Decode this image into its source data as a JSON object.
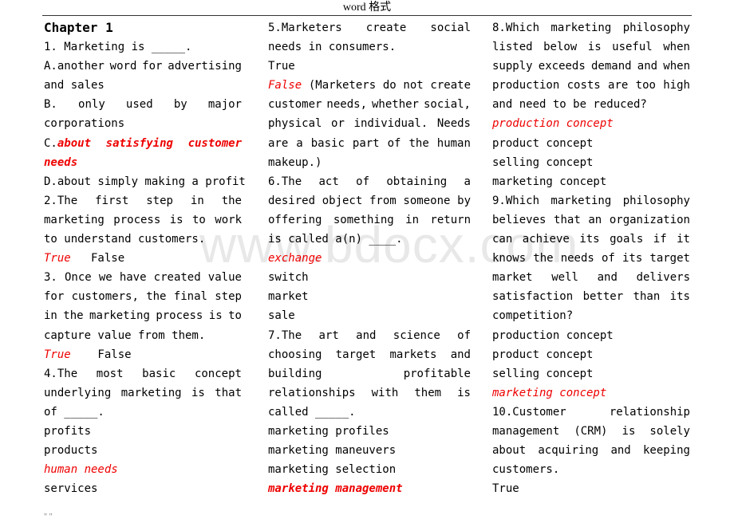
{
  "header": {
    "title": "word 格式"
  },
  "watermark": "www.bdocx.com",
  "footer": {
    "text": "\" \""
  },
  "columns": [
    {
      "lines": [
        {
          "text": "Chapter 1",
          "style": "chapter"
        },
        {
          "text": "1. Marketing is _____."
        },
        {
          "text": "A.another word for advertising",
          "justify": true
        },
        {
          "text": "and sales"
        },
        {
          "text": "B.    only    used    by    major",
          "justify": true
        },
        {
          "text": "corporations"
        },
        {
          "prefix": "C.",
          "text": "about  satisfying  customer",
          "style": "ans-bold",
          "justify": true
        },
        {
          "text": "needs",
          "style": "ans-bold"
        },
        {
          "text": "D.about simply making a profit"
        },
        {
          "text": "2.The  first  step  in  the",
          "justify": true
        },
        {
          "text": "marketing process is to work",
          "justify": true
        },
        {
          "text": "to understand customers."
        },
        {
          "text": "True",
          "style": "ans",
          "suffix": "   False"
        },
        {
          "text": "3. Once we have created value",
          "justify": true
        },
        {
          "text": "for customers, the final step",
          "justify": true
        },
        {
          "text": "in the marketing process is to",
          "justify": true
        },
        {
          "text": "capture value from them."
        },
        {
          "text": "True",
          "style": "ans",
          "suffix": "    False"
        },
        {
          "text": "4.The  most  basic  concept",
          "justify": true
        },
        {
          "text": "underlying marketing is that",
          "justify": true
        },
        {
          "text": "of _____."
        },
        {
          "text": "profits"
        },
        {
          "text": "products"
        },
        {
          "text": "human needs",
          "style": "ans"
        },
        {
          "text": "services"
        }
      ]
    },
    {
      "lines": [
        {
          "text": "5.Marketers  create  social",
          "justify": true
        },
        {
          "text": "needs in consumers."
        },
        {
          "text": "True"
        },
        {
          "text": "False",
          "style": "ans",
          "suffix": " (Marketers do not create",
          "justify": true
        },
        {
          "text": "customer needs, whether social,",
          "justify": true
        },
        {
          "text": "physical or individual.  Needs",
          "justify": true
        },
        {
          "text": "are a basic part of the human",
          "justify": true
        },
        {
          "text": "makeup.)"
        },
        {
          "text": "6.The  act  of  obtaining  a",
          "justify": true
        },
        {
          "text": "desired object from someone by",
          "justify": true
        },
        {
          "text": "offering something in return",
          "justify": true
        },
        {
          "text": "is called a(n) ____."
        },
        {
          "text": "exchange",
          "style": "ans"
        },
        {
          "text": "switch"
        },
        {
          "text": "market"
        },
        {
          "text": "sale"
        },
        {
          "text": "7.The  art  and  science  of",
          "justify": true
        },
        {
          "text": "choosing target markets and",
          "justify": true
        },
        {
          "text": "building  profitable",
          "justify": true
        },
        {
          "text": "relationships with them is",
          "justify": true
        },
        {
          "text": "called _____."
        },
        {
          "text": "marketing profiles"
        },
        {
          "text": "marketing maneuvers"
        },
        {
          "text": "marketing selection"
        },
        {
          "text": "marketing management",
          "style": "ans-bold"
        }
      ]
    },
    {
      "lines": [
        {
          "text": "8.Which marketing philosophy",
          "justify": true
        },
        {
          "text": "listed below is useful when",
          "justify": true
        },
        {
          "text": "supply exceeds demand and when",
          "justify": true
        },
        {
          "text": "production costs are too high",
          "justify": true
        },
        {
          "text": "and need to be reduced?"
        },
        {
          "text": "production concept",
          "style": "ans"
        },
        {
          "text": "product concept"
        },
        {
          "text": "selling concept"
        },
        {
          "text": "marketing concept"
        },
        {
          "text": "9.Which marketing philosophy",
          "justify": true
        },
        {
          "text": "believes that an organization",
          "justify": true
        },
        {
          "text": "can achieve its goals if it",
          "justify": true
        },
        {
          "text": "knows the needs of its target",
          "justify": true
        },
        {
          "text": "market well and delivers",
          "justify": true
        },
        {
          "text": "satisfaction better than its",
          "justify": true
        },
        {
          "text": "competition?"
        },
        {
          "text": "production concept"
        },
        {
          "text": "product concept"
        },
        {
          "text": "selling concept"
        },
        {
          "text": "marketing concept",
          "style": "ans"
        },
        {
          "text": "10.Customer  relationship",
          "justify": true
        },
        {
          "text": "management (CRM) is solely",
          "justify": true
        },
        {
          "text": "about acquiring and keeping",
          "justify": true
        },
        {
          "text": "customers."
        },
        {
          "text": "True"
        }
      ]
    }
  ]
}
